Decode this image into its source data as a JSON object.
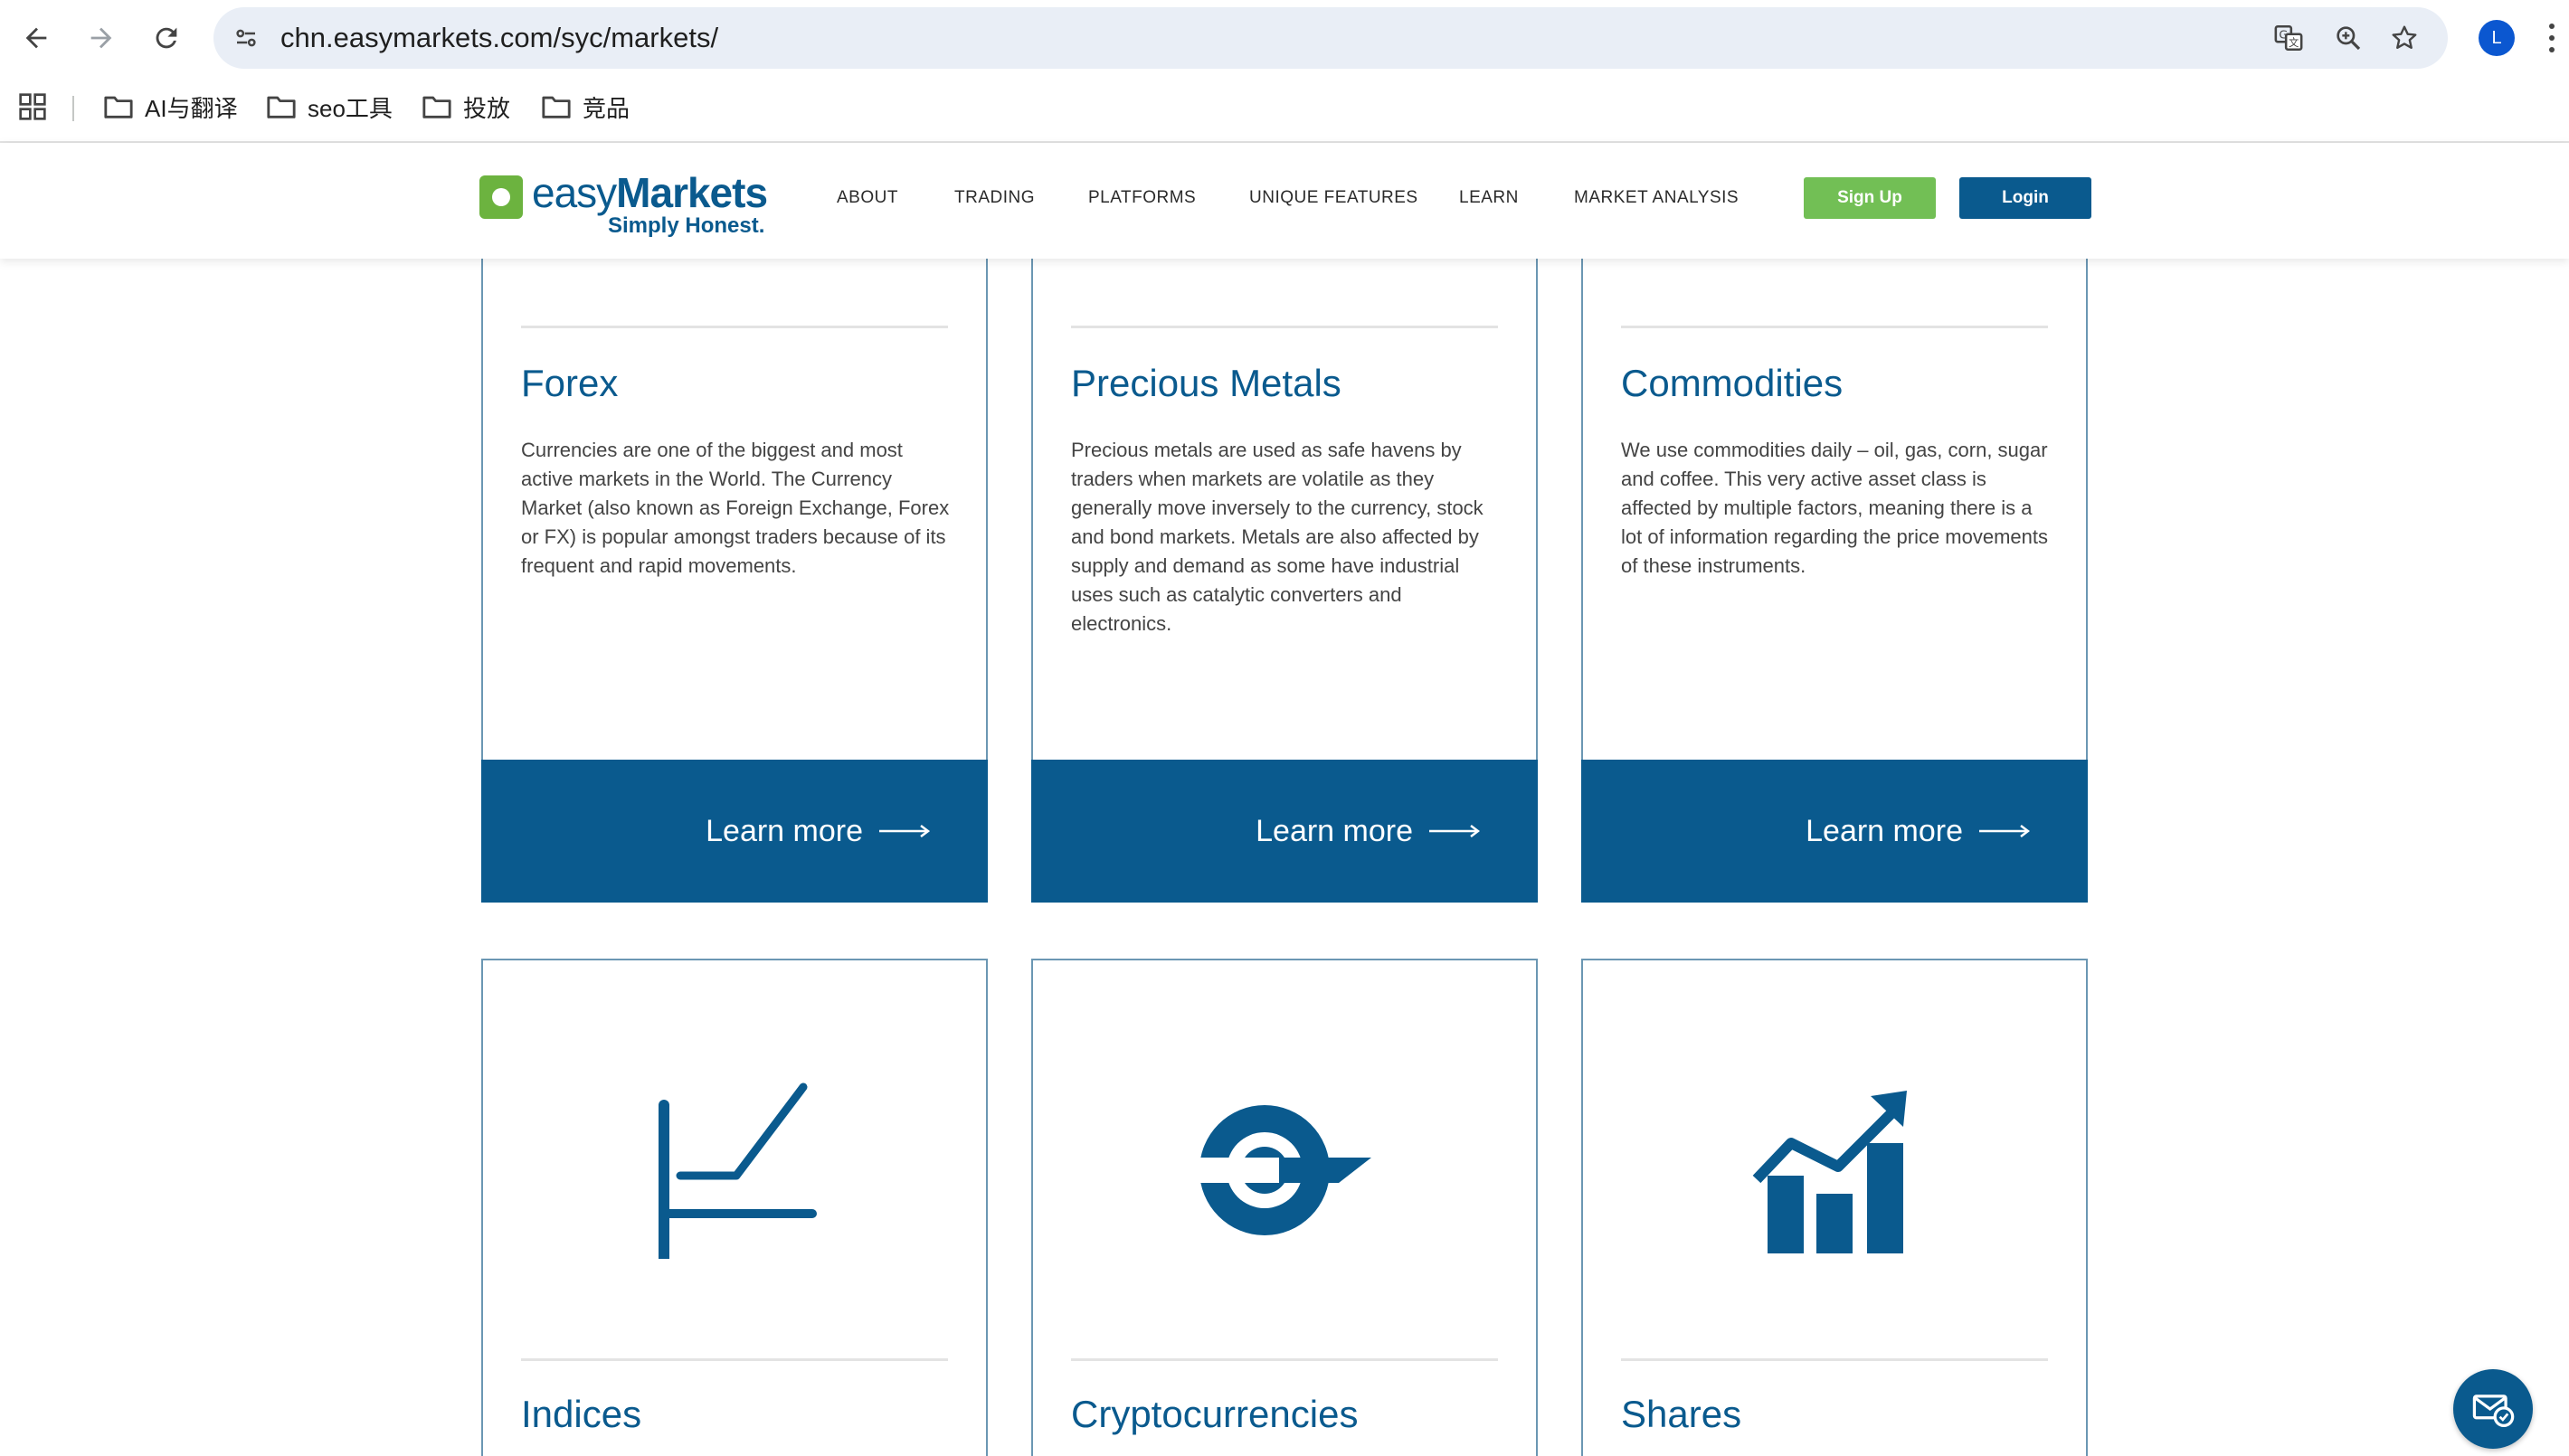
{
  "browser": {
    "url": "chn.easymarkets.com/syc/markets/",
    "profile_initial": "L",
    "bookmarks": [
      {
        "label": "AI与翻译"
      },
      {
        "label": "seo工具"
      },
      {
        "label": "投放"
      },
      {
        "label": "竞品"
      }
    ]
  },
  "header": {
    "logo_word_light": "easy",
    "logo_word_bold": "Markets",
    "logo_tagline": "Simply Honest.",
    "nav": [
      "ABOUT",
      "TRADING",
      "PLATFORMS",
      "UNIQUE FEATURES",
      "LEARN",
      "MARKET ANALYSIS"
    ],
    "signup_label": "Sign Up",
    "login_label": "Login"
  },
  "markets": [
    {
      "title": "Forex",
      "description": "Currencies are one of the biggest and most active markets in the World. The Currency Market (also known as Foreign Exchange, Forex or FX) is popular amongst traders because of its frequent and rapid movements.",
      "cta": "Learn more",
      "icon": "arrow-right-icon"
    },
    {
      "title": "Precious Metals",
      "description": "Precious metals are used as safe havens by traders when markets are volatile as they generally move inversely to the currency, stock and bond markets. Metals are also affected by supply and demand as some have industrial uses such as catalytic converters and electronics.",
      "cta": "Learn more",
      "icon": "arrow-right-icon"
    },
    {
      "title": "Commodities",
      "description": "We use commodities daily – oil, gas, corn, sugar and coffee. This very active asset class is affected by multiple factors, meaning there is a lot of information regarding the price movements of these instruments.",
      "cta": "Learn more",
      "icon": "arrow-right-icon"
    },
    {
      "title": "Indices",
      "icon": "index-line-chart-icon"
    },
    {
      "title": "Cryptocurrencies",
      "icon": "crypto-coin-icon"
    },
    {
      "title": "Shares",
      "icon": "bar-chart-up-icon"
    }
  ],
  "colors": {
    "brand_blue": "#0a5a8e",
    "brand_green": "#6cb33f",
    "card_border": "#6b97b3"
  }
}
